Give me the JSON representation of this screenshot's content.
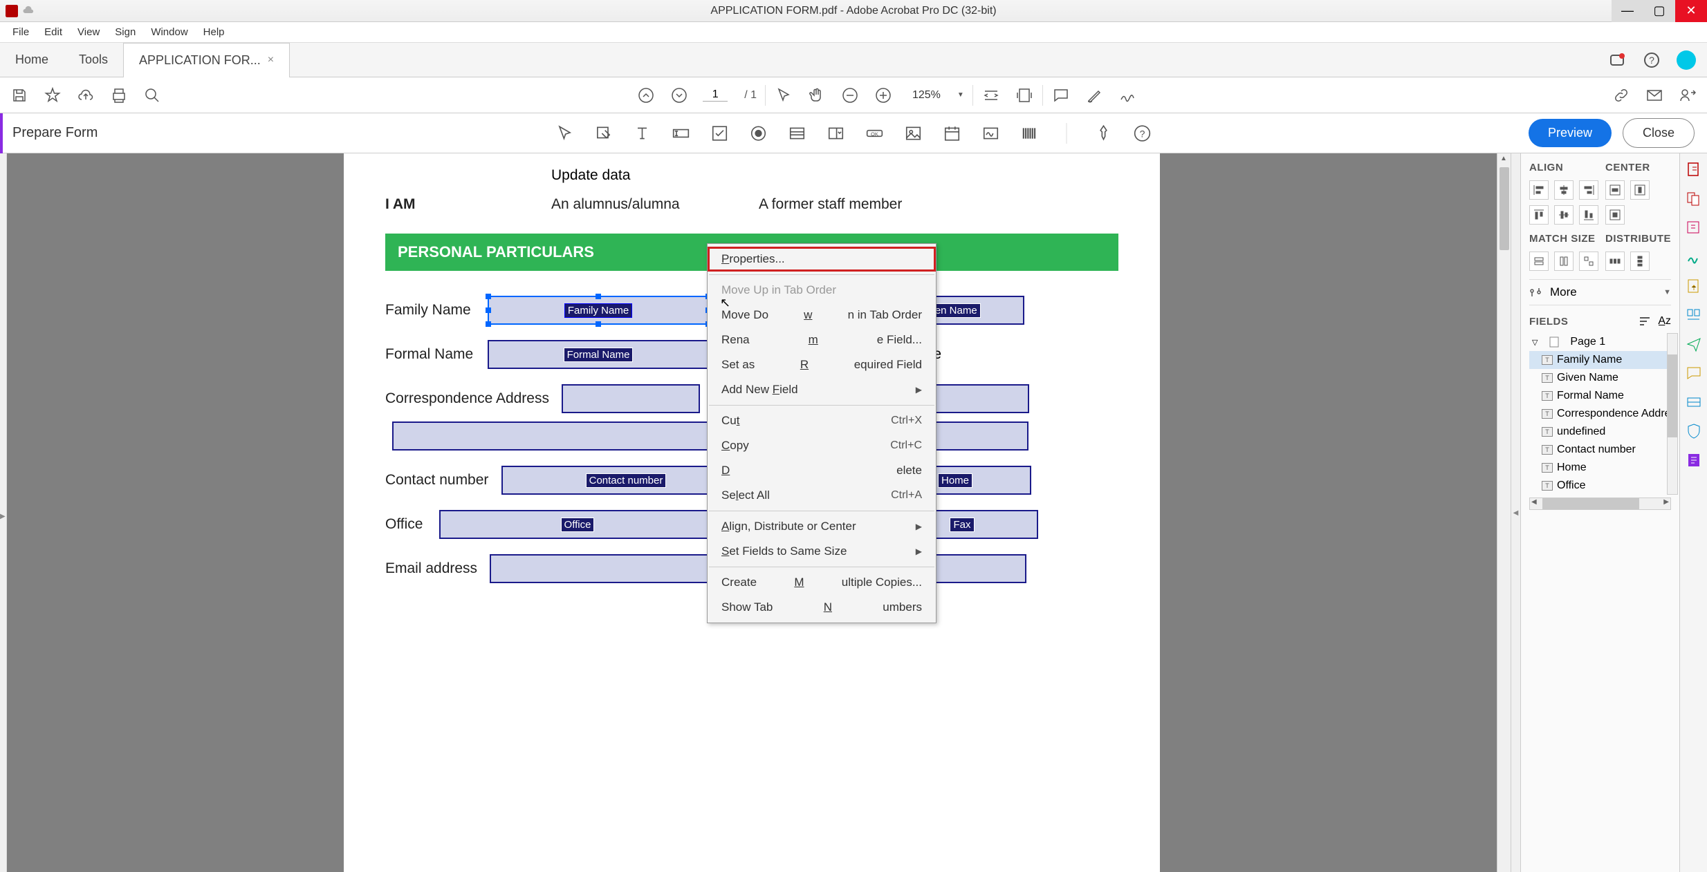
{
  "titlebar": {
    "title": "APPLICATION FORM.pdf - Adobe Acrobat Pro DC (32-bit)"
  },
  "menubar": {
    "items": [
      "File",
      "Edit",
      "View",
      "Sign",
      "Window",
      "Help"
    ]
  },
  "tabs": {
    "home": "Home",
    "tools": "Tools",
    "doc": "APPLICATION FOR..."
  },
  "toolbar": {
    "page_current": "1",
    "page_total": "/ 1",
    "zoom": "125%"
  },
  "prepare": {
    "label": "Prepare Form",
    "preview": "Preview",
    "close": "Close"
  },
  "document": {
    "update": "Update data",
    "iam": "I AM",
    "alumnus": "An alumnus/alumna",
    "former": "A former staff member",
    "section": "PERSONAL PARTICULARS",
    "family_name_label": "Family Name",
    "family_name_tag": "Family Name",
    "given_name_tag": "Given Name",
    "formal_name_label": "Formal Name",
    "formal_name_tag": "Formal Name",
    "female": "Female",
    "corr_label": "Correspondence Address",
    "contact_label": "Contact number",
    "contact_tag": "Contact number",
    "home_tag": "Home",
    "office_label": "Office",
    "office_tag": "Office",
    "fax_tag": "Fax",
    "email_label": "Email address"
  },
  "context_menu": {
    "properties": "Properties...",
    "move_up": "Move Up in Tab Order",
    "move_down": "Move Down in Tab Order",
    "rename": "Rename Field...",
    "required": "Set as Required Field",
    "add_new": "Add New Field",
    "cut": "Cut",
    "cut_key": "Ctrl+X",
    "copy": "Copy",
    "copy_key": "Ctrl+C",
    "delete": "Delete",
    "select_all": "Select All",
    "select_all_key": "Ctrl+A",
    "align": "Align, Distribute or Center",
    "same_size": "Set Fields to Same Size",
    "multiple": "Create Multiple Copies...",
    "show_tab": "Show Tab Numbers"
  },
  "right_panel": {
    "align": "ALIGN",
    "center": "CENTER",
    "match_size": "MATCH SIZE",
    "distribute": "DISTRIBUTE",
    "more": "More",
    "fields": "FIELDS",
    "page1": "Page 1",
    "items": [
      "Family Name",
      "Given Name",
      "Formal Name",
      "Correspondence Addre",
      "undefined",
      "Contact number",
      "Home",
      "Office"
    ]
  }
}
